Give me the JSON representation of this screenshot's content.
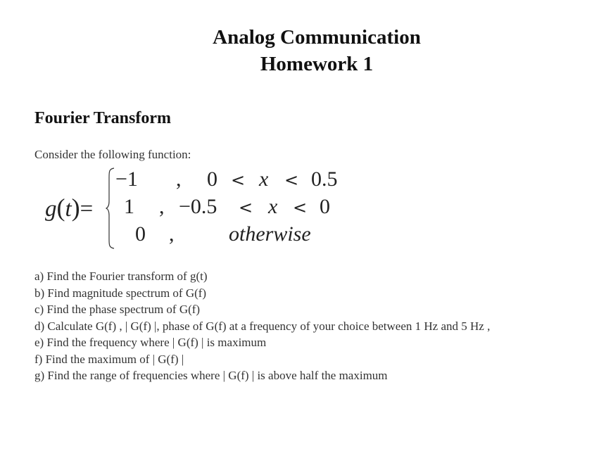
{
  "header": {
    "title_line1": "Analog Communication",
    "title_line2": "Homework 1"
  },
  "section": {
    "heading": "Fourier Transform",
    "intro": "Consider the following function:"
  },
  "equation": {
    "function_name": "g",
    "variable": "t",
    "equals": "=",
    "cases": [
      {
        "value": "−1",
        "comma": ",",
        "lower": "0",
        "var": "x",
        "upper": "0.5",
        "lt": "<"
      },
      {
        "value": "1",
        "comma": ",",
        "lower": "−0.5",
        "var": "x",
        "upper": "0",
        "lt": "<"
      },
      {
        "value": "0",
        "comma": ",",
        "condition": "otherwise"
      }
    ]
  },
  "questions": [
    "a) Find the Fourier transform of g(t)",
    "b) Find magnitude spectrum of G(f)",
    "c) Find the phase spectrum of G(f)",
    "d) Calculate G(f) , | G(f) |, phase of G(f) at a frequency of your choice between 1 Hz and 5 Hz ,",
    "e) Find the frequency where | G(f) | is maximum",
    "f) Find the maximum of | G(f) |",
    "g) Find the range of frequencies where | G(f) | is above half the maximum"
  ]
}
